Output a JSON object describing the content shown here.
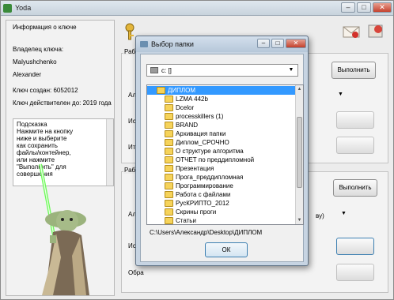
{
  "window": {
    "title": "Yoda"
  },
  "info": {
    "title": "Информация о ключе",
    "owner_label": "Владелец ключа:",
    "owner_name": "Malyushchenko",
    "owner_first": "Alexander",
    "created": "Ключ создан: 6052012",
    "valid": "Ключ действителен до: 2019 года"
  },
  "hint": {
    "title": "Подсказка",
    "lines": [
      "Нажмите на кнопку",
      "ниже и выберите",
      "как сохранить",
      "файлы/контейнер,",
      "или нажмите",
      "\"Выполнить\" для",
      "совершения"
    ]
  },
  "group1": {
    "label": "Рабо",
    "row1": "Алг",
    "row2": "Исх",
    "row3": "Итог"
  },
  "group2": {
    "label": "Рабо",
    "row1": "Алг",
    "row2": "Исх",
    "row3": "Обра",
    "combo_tail": "ву)"
  },
  "buttons": {
    "execute_top": "Выполнить",
    "execute_bottom": "Выполнить"
  },
  "dialog": {
    "title": "Выбор папки",
    "drive": "c: []",
    "path": "C:\\Users\\Александр\\Desktop\\ДИПЛОМ",
    "ok": "ОК",
    "folders": [
      "ДИПЛОМ",
      "LZMA 442b",
      "Dcelor",
      "processkillers (1)",
      "BRAND",
      "Архивация папки",
      "Диплом_СРОЧНО",
      "О структуре алгоритма",
      "ОТЧЕТ по преддипломной",
      "Презентация",
      "Прога_преддипломная",
      "Программирование",
      "Работа с файлами",
      "РусКРИПТО_2012",
      "Скрины проги",
      "Статьи"
    ]
  }
}
